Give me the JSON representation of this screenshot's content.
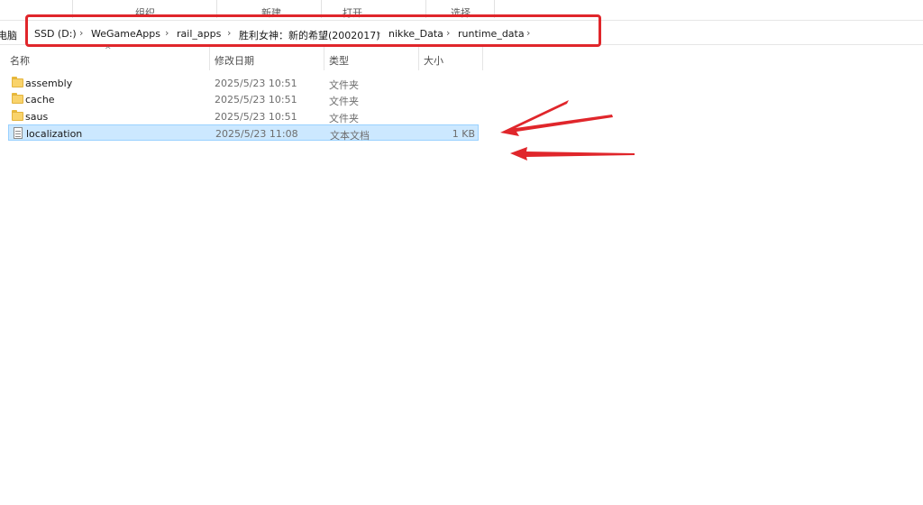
{
  "ribbon": {
    "groups": [
      "组织",
      "新建",
      "打开",
      "选择"
    ]
  },
  "address": {
    "prefix": "电脑",
    "crumbs": [
      "SSD (D:)",
      "WeGameApps",
      "rail_apps",
      "胜利女神：新的希望(2002017)",
      "nikke_Data",
      "runtime_data"
    ]
  },
  "columns": {
    "name": "名称",
    "date": "修改日期",
    "type": "类型",
    "size": "大小"
  },
  "files": [
    {
      "name": "assembly",
      "date": "2025/5/23 10:51",
      "type": "文件夹",
      "size": "",
      "kind": "folder-icon"
    },
    {
      "name": "cache",
      "date": "2025/5/23 10:51",
      "type": "文件夹",
      "size": "",
      "kind": "folder-icon"
    },
    {
      "name": "saus",
      "date": "2025/5/23 10:51",
      "type": "文件夹",
      "size": "",
      "kind": "folder-icon"
    },
    {
      "name": "localization",
      "date": "2025/5/23 11:08",
      "type": "文本文档",
      "size": "1 KB",
      "kind": "text-file-icon"
    }
  ],
  "colors": {
    "annotation": "#e0262b",
    "selection": "#cce8ff",
    "selection_border": "#99d1ff"
  }
}
